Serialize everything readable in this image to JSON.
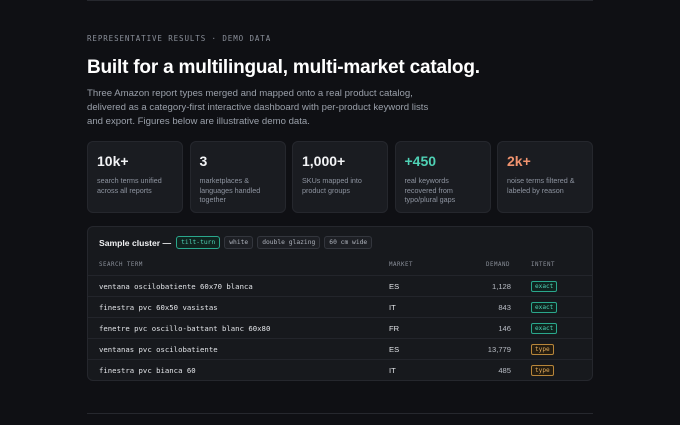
{
  "eyebrow": "REPRESENTATIVE RESULTS · DEMO DATA",
  "headline": "Built for a multilingual, multi-market catalog.",
  "lede": "Three Amazon report types merged and mapped onto a real product catalog, delivered as a category-first interactive dashboard with per-product keyword lists and export. Figures below are illustrative demo data.",
  "stats": [
    {
      "value": "10k+",
      "desc": "search terms unified across all reports",
      "accent": "#f2f3f5"
    },
    {
      "value": "3",
      "desc": "marketplaces & languages handled together",
      "accent": "#f2f3f5"
    },
    {
      "value": "1,000+",
      "desc": "SKUs mapped into product groups",
      "accent": "#f2f3f5"
    },
    {
      "value": "+450",
      "desc": "real keywords recovered from typo/plural gaps",
      "accent": "#4fd1b5"
    },
    {
      "value": "2k+",
      "desc": "noise terms filtered & labeled by reason",
      "accent": "#f0936f"
    }
  ],
  "cluster": {
    "title": "Sample cluster —",
    "chips": [
      "tilt-turn",
      "white",
      "double glazing",
      "60 cm wide"
    ],
    "headers": {
      "term": "SEARCH TERM",
      "market": "MARKET",
      "demand": "DEMAND",
      "intent": "INTENT"
    },
    "rows": [
      {
        "term": "ventana oscilobatiente 60x70 blanca",
        "market": "ES",
        "demand": "1,128",
        "intent": "exact"
      },
      {
        "term": "finestra pvc 60x50 vasistas",
        "market": "IT",
        "demand": "843",
        "intent": "exact"
      },
      {
        "term": "fenetre pvc oscillo-battant blanc 60x80",
        "market": "FR",
        "demand": "146",
        "intent": "exact"
      },
      {
        "term": "ventanas pvc oscilobatiente",
        "market": "ES",
        "demand": "13,779",
        "intent": "type"
      },
      {
        "term": "finestra pvc bianca 60",
        "market": "IT",
        "demand": "485",
        "intent": "type"
      }
    ]
  },
  "colors": {
    "accent_teal": "#4fd1b5",
    "accent_salmon": "#f0936f",
    "type_amber": "#e2ab5b",
    "background": "#0f1014"
  }
}
